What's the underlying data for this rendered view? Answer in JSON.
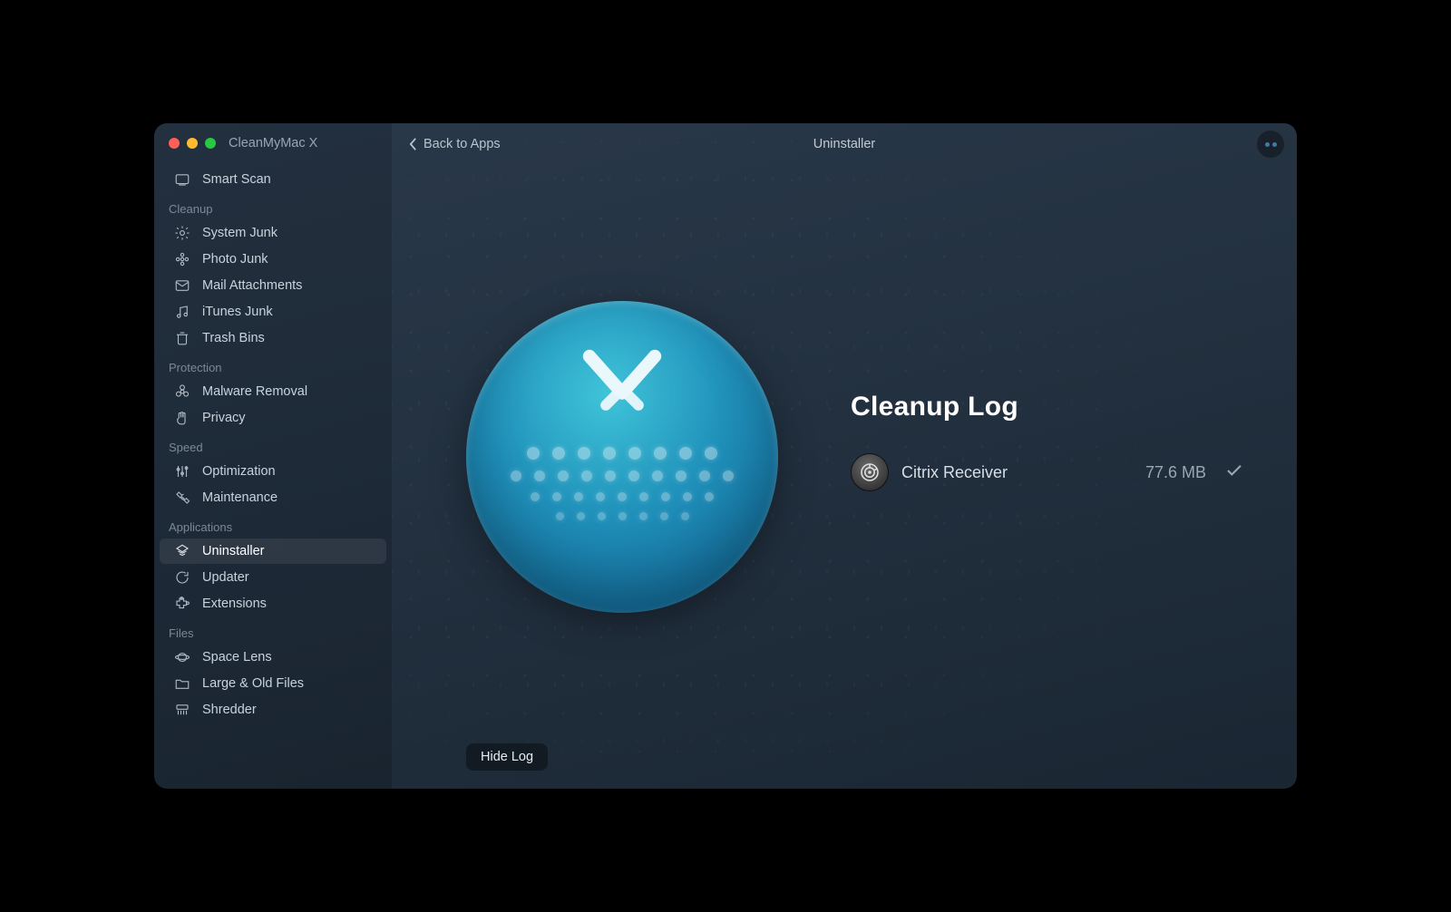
{
  "app_title": "CleanMyMac X",
  "header": {
    "back_label": "Back to Apps",
    "page_title": "Uninstaller"
  },
  "sidebar": {
    "smart_scan": "Smart Scan",
    "sections": {
      "cleanup": {
        "label": "Cleanup",
        "items": [
          "System Junk",
          "Photo Junk",
          "Mail Attachments",
          "iTunes Junk",
          "Trash Bins"
        ]
      },
      "protection": {
        "label": "Protection",
        "items": [
          "Malware Removal",
          "Privacy"
        ]
      },
      "speed": {
        "label": "Speed",
        "items": [
          "Optimization",
          "Maintenance"
        ]
      },
      "applications": {
        "label": "Applications",
        "items": [
          "Uninstaller",
          "Updater",
          "Extensions"
        ]
      },
      "files": {
        "label": "Files",
        "items": [
          "Space Lens",
          "Large & Old Files",
          "Shredder"
        ]
      }
    }
  },
  "main": {
    "heading": "Cleanup Log",
    "log": [
      {
        "name": "Citrix Receiver",
        "size": "77.6 MB",
        "done": true
      }
    ],
    "hide_log_label": "Hide Log"
  }
}
